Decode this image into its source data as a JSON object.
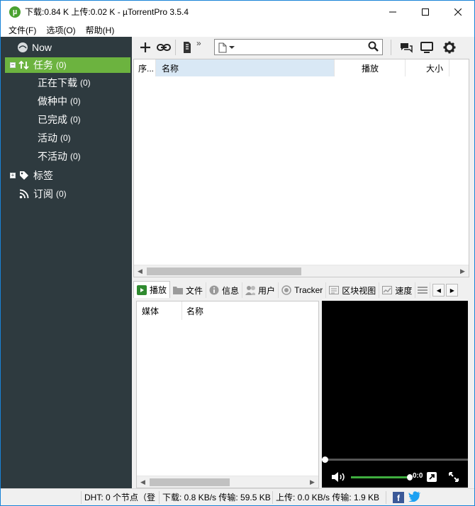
{
  "titlebar": {
    "title": "下载:0.84 K 上传:0.02 K - µTorrentPro 3.5.4",
    "minimize": "—",
    "maximize": "☐",
    "close": "✕"
  },
  "menu": [
    "文件(F)",
    "选项(O)",
    "帮助(H)"
  ],
  "sidebar": {
    "now": "Now",
    "tasks": {
      "label": "任务",
      "count": "(0)",
      "expander": "−"
    },
    "task_items": [
      {
        "label": "正在下载",
        "count": "(0)"
      },
      {
        "label": "做种中",
        "count": "(0)"
      },
      {
        "label": "已完成",
        "count": "(0)"
      },
      {
        "label": "活动",
        "count": "(0)"
      },
      {
        "label": "不活动",
        "count": "(0)"
      }
    ],
    "labels": {
      "label": "标签",
      "expander": "+"
    },
    "feeds": {
      "label": "订阅",
      "count": "(0)"
    }
  },
  "toolbar": {
    "more": "»",
    "icons": [
      "add-torrent-icon",
      "add-url-icon",
      "create-torrent-icon",
      "file-type-icon",
      "search-icon",
      "chat-icon",
      "remote-icon",
      "settings-icon"
    ]
  },
  "torrent_list": {
    "columns": [
      "序...",
      "名称",
      "播放",
      "大小"
    ]
  },
  "tabs": [
    "播放",
    "文件",
    "信息",
    "用户",
    "Tracker",
    "区块视图",
    "速度"
  ],
  "media_list": {
    "columns": [
      "媒体",
      "名称"
    ]
  },
  "player": {
    "time": "0:0"
  },
  "statusbar": {
    "dht": "DHT: 0 个节点（登",
    "download": "下载: 0.8 KB/s 传输: 59.5 KB",
    "upload": "上传: 0.0 KB/s 传输: 1.9 KB"
  },
  "colors": {
    "sidebar_bg": "#2e3a3f",
    "selected_green": "#6cb33f",
    "header_highlight": "#d9e8f5"
  }
}
